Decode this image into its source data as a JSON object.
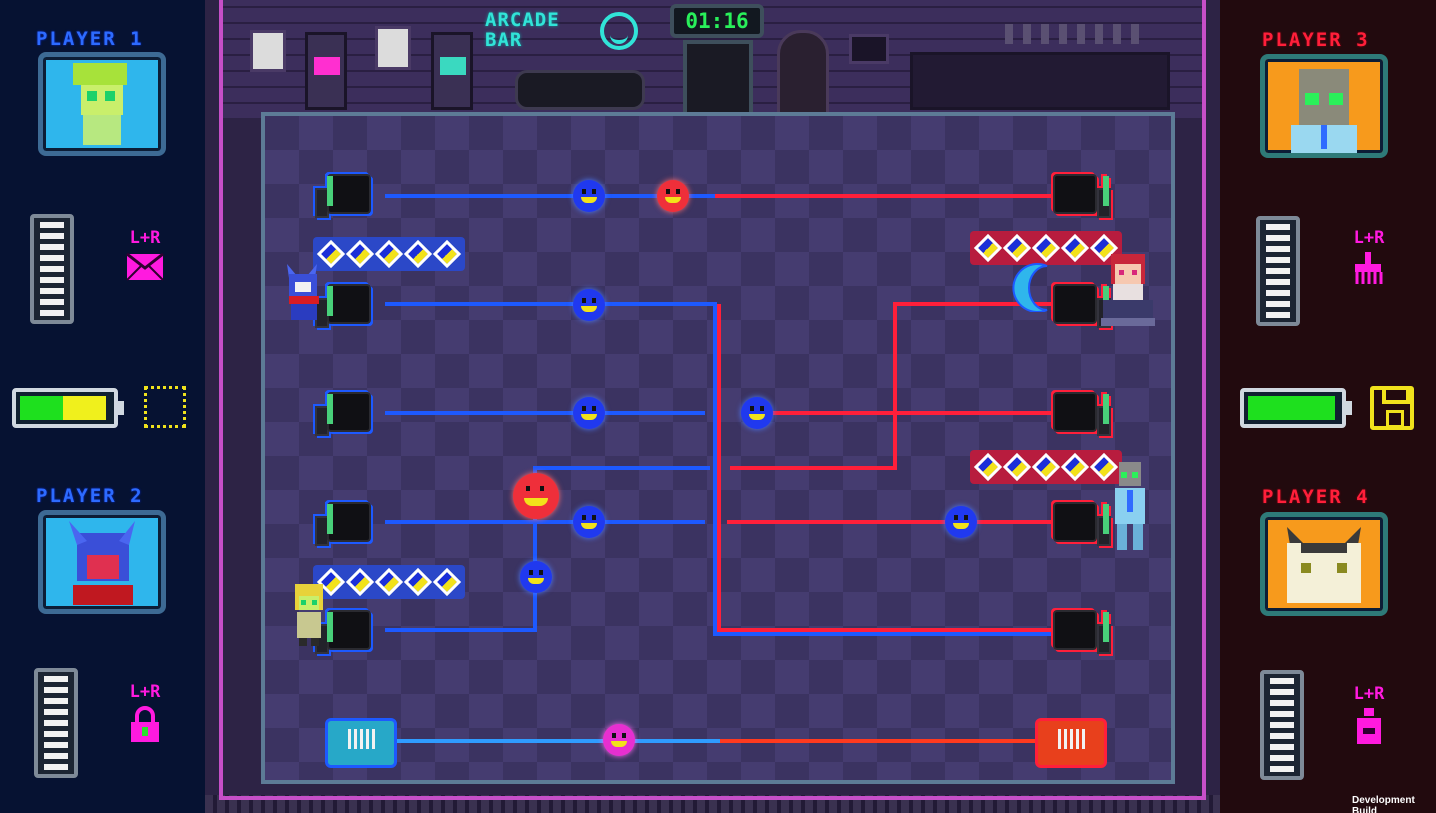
{
  "hud": {
    "timer": "01:16",
    "logo_line1": "ARCADE",
    "logo_line2": "BAR",
    "build_label": "Development Build"
  },
  "players": [
    {
      "label": "PLAYER 1",
      "team": "blue",
      "combo": "L+R",
      "combo_icon": "envelope-icon",
      "battery_green": 0.5,
      "battery_yellow": 0.5,
      "item": "empty-slot"
    },
    {
      "label": "PLAYER 2",
      "team": "blue",
      "combo": "L+R",
      "combo_icon": "lock-icon"
    },
    {
      "label": "PLAYER 3",
      "team": "red",
      "combo": "L+R",
      "combo_icon": "broom-icon",
      "battery_green": 0.97,
      "item": "floppy-disk-icon"
    },
    {
      "label": "PLAYER 4",
      "team": "red",
      "combo": "L+R",
      "combo_icon": "spray-can-icon"
    }
  ],
  "colors": {
    "blue_team": "#1d59ff",
    "red_team": "#ff1f3a",
    "combo": "#ff1adf",
    "item": "#f0e21c",
    "timer": "#29f05a"
  }
}
